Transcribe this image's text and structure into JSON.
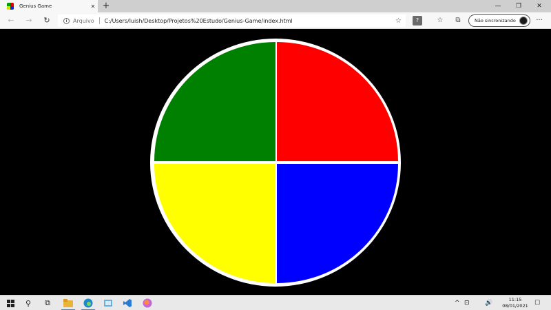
{
  "browser": {
    "tab": {
      "title": "Genius Game",
      "close_glyph": "✕",
      "favicon_colors": [
        "#00a000",
        "#e00000",
        "#e0e000",
        "#0030e0"
      ]
    },
    "new_tab_glyph": "+",
    "window_controls": {
      "minimize": "—",
      "restore": "❐",
      "close": "✕"
    },
    "nav": {
      "back": "←",
      "forward": "→",
      "refresh": "↻"
    },
    "address": {
      "origin": "Arquivo",
      "url": "C:/Users/luish/Desktop/Projetos%20Estudo/Genius-Game/index.html",
      "favorite_glyph": "☆"
    },
    "toolbar": {
      "help_glyph": "?",
      "favorites_glyph": "☆",
      "collections_glyph": "⧉",
      "more_glyph": "···"
    },
    "sync_label": "Não sincronizando"
  },
  "game": {
    "background": "#000000",
    "board_border_color": "#ffffff",
    "quadrants": [
      {
        "id": "green",
        "color": "#008000"
      },
      {
        "id": "red",
        "color": "#ff0000"
      },
      {
        "id": "yellow",
        "color": "#ffff00"
      },
      {
        "id": "blue",
        "color": "#0000ff"
      }
    ]
  },
  "taskbar": {
    "search_glyph": "⚲",
    "task_view_glyph": "⧉",
    "apps": [
      {
        "name": "file-explorer",
        "color": "#e8b53a"
      },
      {
        "name": "edge",
        "color": "#1e88c8"
      },
      {
        "name": "app",
        "color": "#6ab0de"
      },
      {
        "name": "vscode",
        "color": "#2a7bd3"
      },
      {
        "name": "firefox",
        "color": "#c566d8"
      }
    ],
    "tray_glyphs": {
      "chevron": "^",
      "network": "⊡",
      "volume": "🔊",
      "notifications": "☐"
    },
    "time": "11:15",
    "date": "08/01/2021"
  }
}
